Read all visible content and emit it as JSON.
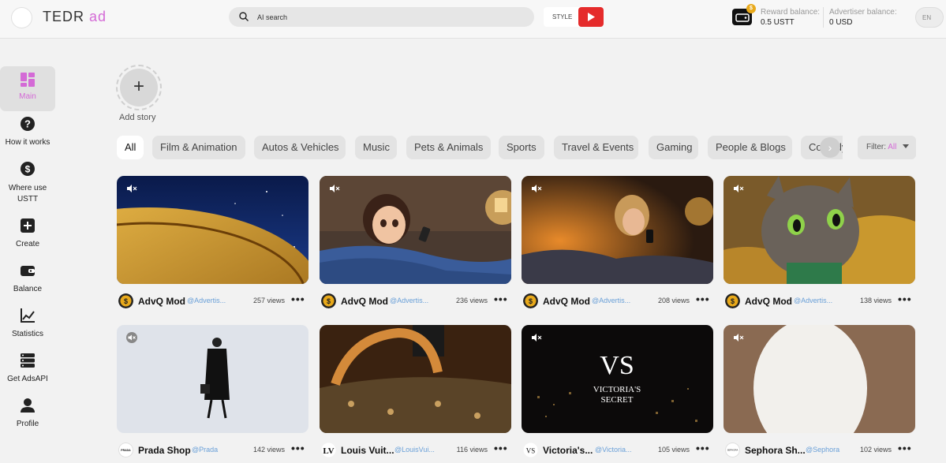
{
  "header": {
    "logo_main": "TEDR",
    "logo_ad": "ad",
    "search_placeholder": "AI search",
    "style_label": "STYLE",
    "reward_label": "Reward balance:",
    "reward_value": "0.5 USTT",
    "advertiser_label": "Advertiser balance:",
    "advertiser_value": "0 USD",
    "language": "EN",
    "coin_badge": "$"
  },
  "sidebar": {
    "items": [
      {
        "label": "Main",
        "icon": "dashboard-icon"
      },
      {
        "label": "How it works",
        "icon": "help-icon"
      },
      {
        "label": "Where use USTT",
        "icon": "dollar-icon"
      },
      {
        "label": "Create",
        "icon": "plus-square-icon"
      },
      {
        "label": "Balance",
        "icon": "wallet-icon"
      },
      {
        "label": "Statistics",
        "icon": "chart-icon"
      },
      {
        "label": "Get AdsAPI",
        "icon": "server-icon"
      },
      {
        "label": "Profile",
        "icon": "user-icon"
      }
    ]
  },
  "story": {
    "label": "Add story",
    "plus": "+"
  },
  "categories": [
    "All",
    "Film & Animation",
    "Autos & Vehicles",
    "Music",
    "Pets & Animals",
    "Sports",
    "Travel & Events",
    "Gaming",
    "People & Blogs",
    "Comedy"
  ],
  "filter": {
    "label": "Filter:",
    "value": "All"
  },
  "cards": [
    {
      "name": "AdvQ Mod",
      "handle": "@Advertis...",
      "views": "257 views",
      "avatar": "coin"
    },
    {
      "name": "AdvQ Mod",
      "handle": "@Advertis...",
      "views": "236 views",
      "avatar": "coin"
    },
    {
      "name": "AdvQ Mod",
      "handle": "@Advertis...",
      "views": "208 views",
      "avatar": "coin"
    },
    {
      "name": "AdvQ Mod",
      "handle": "@Advertis...",
      "views": "138 views",
      "avatar": "coin"
    },
    {
      "name": "Prada Shop",
      "handle": "@Prada",
      "views": "142 views",
      "avatar": "prada"
    },
    {
      "name": "Louis Vuit...",
      "handle": "@LouisVui...",
      "views": "116 views",
      "avatar": "lv"
    },
    {
      "name": "Victoria's...",
      "handle": "@Victoria...",
      "views": "105 views",
      "avatar": "vs"
    },
    {
      "name": "Sephora Sh...",
      "handle": "@Sephora",
      "views": "102 views",
      "avatar": "sephora"
    }
  ],
  "thumb_text": {
    "brand_line1": "VICTORIA'S",
    "brand_line2": "SECRET",
    "avatar_prada": "PRADA",
    "avatar_sephora": "SEPHORA"
  },
  "more_label": "•••",
  "colors": {
    "accent": "#d46ad6",
    "youtube": "#e52b2b",
    "link": "#6aa0d8",
    "coin": "#e8a91b"
  }
}
